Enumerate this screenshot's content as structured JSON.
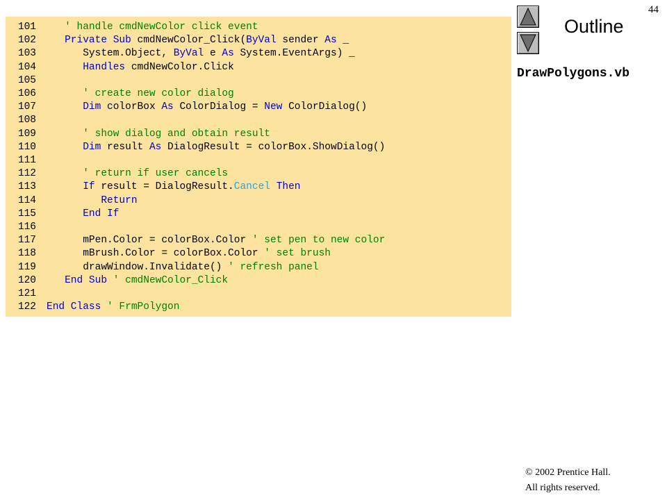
{
  "slide": {
    "number": "44",
    "outline_label": "Outline",
    "filename": "DrawPolygons.vb",
    "copyright_line1": "© 2002 Prentice Hall.",
    "copyright_line2": "All rights reserved.",
    "nav_up_icon": "triangle-up-icon",
    "nav_down_icon": "triangle-down-icon"
  },
  "colors": {
    "code_background": "#fce3a0",
    "keyword": "#0000cc",
    "comment": "#008000",
    "member": "#2aa5d8",
    "text": "#000000"
  },
  "code_lines": [
    {
      "num": "101",
      "indent": 1,
      "tokens": [
        {
          "t": "' handle cmdNewColor click event",
          "c": "cm"
        }
      ]
    },
    {
      "num": "102",
      "indent": 1,
      "tokens": [
        {
          "t": "Private Sub",
          "c": "kw"
        },
        {
          "t": " cmdNewColor_Click(",
          "c": "tx"
        },
        {
          "t": "ByVal",
          "c": "kw"
        },
        {
          "t": " sender ",
          "c": "tx"
        },
        {
          "t": "As",
          "c": "kw"
        },
        {
          "t": " _",
          "c": "tx"
        }
      ]
    },
    {
      "num": "103",
      "indent": 2,
      "tokens": [
        {
          "t": "System.Object, ",
          "c": "tx"
        },
        {
          "t": "ByVal",
          "c": "kw"
        },
        {
          "t": " e ",
          "c": "tx"
        },
        {
          "t": "As",
          "c": "kw"
        },
        {
          "t": " System.EventArgs) _",
          "c": "tx"
        }
      ]
    },
    {
      "num": "104",
      "indent": 2,
      "tokens": [
        {
          "t": "Handles",
          "c": "kw"
        },
        {
          "t": " cmdNewColor.Click",
          "c": "tx"
        }
      ]
    },
    {
      "num": "105",
      "indent": 0,
      "tokens": []
    },
    {
      "num": "106",
      "indent": 2,
      "tokens": [
        {
          "t": "' create new color dialog",
          "c": "cm"
        }
      ]
    },
    {
      "num": "107",
      "indent": 2,
      "tokens": [
        {
          "t": "Dim",
          "c": "kw"
        },
        {
          "t": " colorBox ",
          "c": "tx"
        },
        {
          "t": "As",
          "c": "kw"
        },
        {
          "t": " ColorDialog = ",
          "c": "tx"
        },
        {
          "t": "New",
          "c": "kw"
        },
        {
          "t": " ColorDialog()",
          "c": "tx"
        }
      ]
    },
    {
      "num": "108",
      "indent": 0,
      "tokens": []
    },
    {
      "num": "109",
      "indent": 2,
      "tokens": [
        {
          "t": "' show dialog and obtain result",
          "c": "cm"
        }
      ]
    },
    {
      "num": "110",
      "indent": 2,
      "tokens": [
        {
          "t": "Dim",
          "c": "kw"
        },
        {
          "t": " result ",
          "c": "tx"
        },
        {
          "t": "As",
          "c": "kw"
        },
        {
          "t": " DialogResult = colorBox.ShowDialog()",
          "c": "tx"
        }
      ]
    },
    {
      "num": "111",
      "indent": 0,
      "tokens": []
    },
    {
      "num": "112",
      "indent": 2,
      "tokens": [
        {
          "t": "' return if user cancels",
          "c": "cm"
        }
      ]
    },
    {
      "num": "113",
      "indent": 2,
      "tokens": [
        {
          "t": "If",
          "c": "kw"
        },
        {
          "t": " result = DialogResult.",
          "c": "tx"
        },
        {
          "t": "Cancel",
          "c": "mb"
        },
        {
          "t": " ",
          "c": "tx"
        },
        {
          "t": "Then",
          "c": "kw"
        }
      ]
    },
    {
      "num": "114",
      "indent": 3,
      "tokens": [
        {
          "t": "Return",
          "c": "kw"
        }
      ]
    },
    {
      "num": "115",
      "indent": 2,
      "tokens": [
        {
          "t": "End If",
          "c": "kw"
        }
      ]
    },
    {
      "num": "116",
      "indent": 0,
      "tokens": []
    },
    {
      "num": "117",
      "indent": 2,
      "tokens": [
        {
          "t": "mPen.Color = colorBox.Color ",
          "c": "tx"
        },
        {
          "t": "' set pen to new color",
          "c": "cm"
        }
      ]
    },
    {
      "num": "118",
      "indent": 2,
      "tokens": [
        {
          "t": "mBrush.Color = colorBox.Color ",
          "c": "tx"
        },
        {
          "t": "' set brush",
          "c": "cm"
        }
      ]
    },
    {
      "num": "119",
      "indent": 2,
      "tokens": [
        {
          "t": "drawWindow.Invalidate() ",
          "c": "tx"
        },
        {
          "t": "' refresh panel",
          "c": "cm"
        }
      ]
    },
    {
      "num": "120",
      "indent": 1,
      "tokens": [
        {
          "t": "End Sub",
          "c": "kw"
        },
        {
          "t": " ",
          "c": "tx"
        },
        {
          "t": "' cmdNewColor_Click",
          "c": "cm"
        }
      ]
    },
    {
      "num": "121",
      "indent": 0,
      "tokens": []
    },
    {
      "num": "122",
      "indent": 0,
      "tokens": [
        {
          "t": "End Class",
          "c": "kw"
        },
        {
          "t": " ",
          "c": "tx"
        },
        {
          "t": "' FrmPolygon",
          "c": "cm"
        }
      ]
    }
  ]
}
